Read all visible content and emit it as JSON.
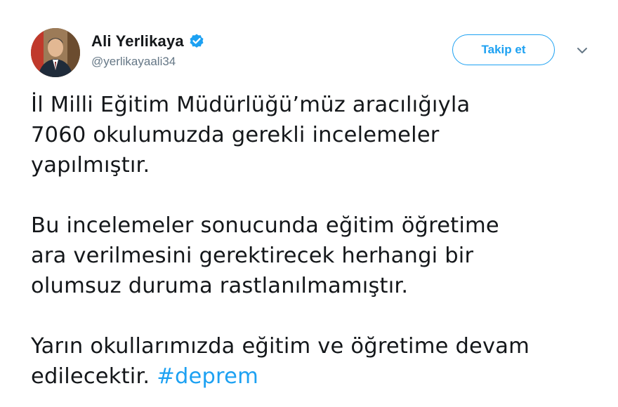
{
  "user": {
    "display_name": "Ali Yerlikaya",
    "handle": "@yerlikayaali34",
    "verified_icon": "verified-badge-icon",
    "avatar_icon": "profile-photo"
  },
  "actions": {
    "follow_label": "Takip et",
    "more_icon": "chevron-down-icon"
  },
  "tweet": {
    "paragraphs": [
      [
        "İl Milli Eğitim Müdürlüğü’müz aracılığıyla",
        "7060 okulumuzda gerekli incelemeler",
        "yapılmıştır."
      ],
      [
        "Bu incelemeler sonucunda eğitim öğretime",
        "ara verilmesini gerektirecek herhangi bir",
        "olumsuz duruma rastlanılmamıştır."
      ],
      [
        "Yarın okullarımızda eğitim ve öğretime devam"
      ]
    ],
    "last_line_text": "edilecektir. ",
    "hashtag": "#deprem"
  },
  "colors": {
    "accent": "#1da1f2",
    "text": "#14171a",
    "secondary": "#657786"
  }
}
